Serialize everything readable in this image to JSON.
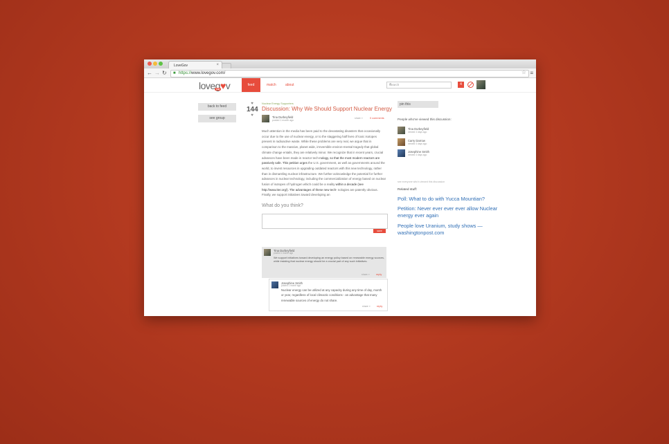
{
  "browser": {
    "tab_title": "LoveGov",
    "tab_close": "×",
    "url_scheme": "https://",
    "url_rest": "www.lovegov.com/",
    "back": "←",
    "forward": "→",
    "reload": "↻",
    "lock": "🔒",
    "star": "☆",
    "menu": "≡"
  },
  "site": {
    "logo_text_left": "love",
    "logo_text_mid": "g",
    "logo_heart": "♥",
    "logo_text_right": "v",
    "logo_badge": "beta",
    "nav": [
      {
        "label": "feed",
        "active": true
      },
      {
        "label": "match",
        "active": false
      },
      {
        "label": "about",
        "active": false
      }
    ],
    "search_placeholder": "Search",
    "search_icon": "search-icon",
    "notification_count": "4"
  },
  "left_sidebar": {
    "back_to_feed": "back to feed",
    "see_group": "see group"
  },
  "post": {
    "vote_up": "♥",
    "vote_down": "♥",
    "score": "144",
    "category": "Nuclear Energy Supporters",
    "title": "Discussion: Why We Should Support Nuclear Energy",
    "author": "Tina Durbeyfield",
    "meta": "posted 1 month ago",
    "share": "share »",
    "comments_link": "0 comments",
    "body_parts": [
      {
        "text": "Much attention in the media has been paid to the devastating disasters that occasionally occur due to the use of nuclear energy, or to the staggering half lives of toxic isotopes present in radioactive waste. While these problems are very real, we argue that in comparison to the massive, planet wide, irreversible environ-mental tragedy that global climate change entails, they are relatively minor. We recognize that in recent years, crucial advances have been made in reactor tech-",
        "strong": false
      },
      {
        "text": "nology, so that the most modern reactors are passively safe. This petition urges",
        "strong": true
      },
      {
        "text": " the U.S. government, as well as governments around the world, to invest resources in upgrading outdated reactors with this new technology, rather than in dismantling nuclear infrastructure. We further acknowledge the potential for further advances in nuclear technology, including the commercialization of energy based on nuclear fusion of isotopes of hydrogen which could be a reality ",
        "strong": false
      },
      {
        "text": "within a decade (see http://www.iter.org/). The advantages of these new tech-",
        "strong": true
      },
      {
        "text": " nologies are patently obvious. Finally, we support initiatives toward developing an",
        "strong": false
      }
    ],
    "what_do_you_think": "What do you think?",
    "save": "save"
  },
  "comments": [
    {
      "author": "Tina Durbeyfield",
      "meta": "posted 1 month ago",
      "text": "We support initiatives toward developing an energy policy based on renewable energy sources, while insisting that nuclear energy should be a crucial part of any such initiatives.",
      "share": "share »",
      "reply": "reply"
    },
    {
      "author": "Josephine Smith",
      "meta": "posted 1 month ago",
      "text": "Nuclear energy can be utilized at any capacity during any time of day, month or year, regardless of local climactic conditions - an advantage that many renewable sources of energy do not share.",
      "share": "share »",
      "reply": "reply"
    }
  ],
  "right_sidebar": {
    "pin": "pin this",
    "viewed_title": "People who've viewed this discussion:",
    "viewers": [
      {
        "name": "Tina Durbeyfield",
        "meta": "viewed 4 days ago",
        "color": "#7d7258"
      },
      {
        "name": "Carry Darrow",
        "meta": "viewed 4 days ago",
        "color": "#a27a4e"
      },
      {
        "name": "Josephine Smith",
        "meta": "viewed 4 days ago",
        "color": "#3f6294"
      }
    ],
    "see_everyone": "see everyone who's viewed this discussion",
    "related_title": "Related stuff:",
    "related": [
      "Poll: What to do with Yucca Mountian?",
      "Petition: Never ever ever ever allow Nuclear energy ever again",
      "People love Uranium, study shows — washingtonpost.com"
    ]
  },
  "colors": {
    "accent": "#e74c3c",
    "link": "#2f6eb5",
    "background": "#b43a20"
  }
}
